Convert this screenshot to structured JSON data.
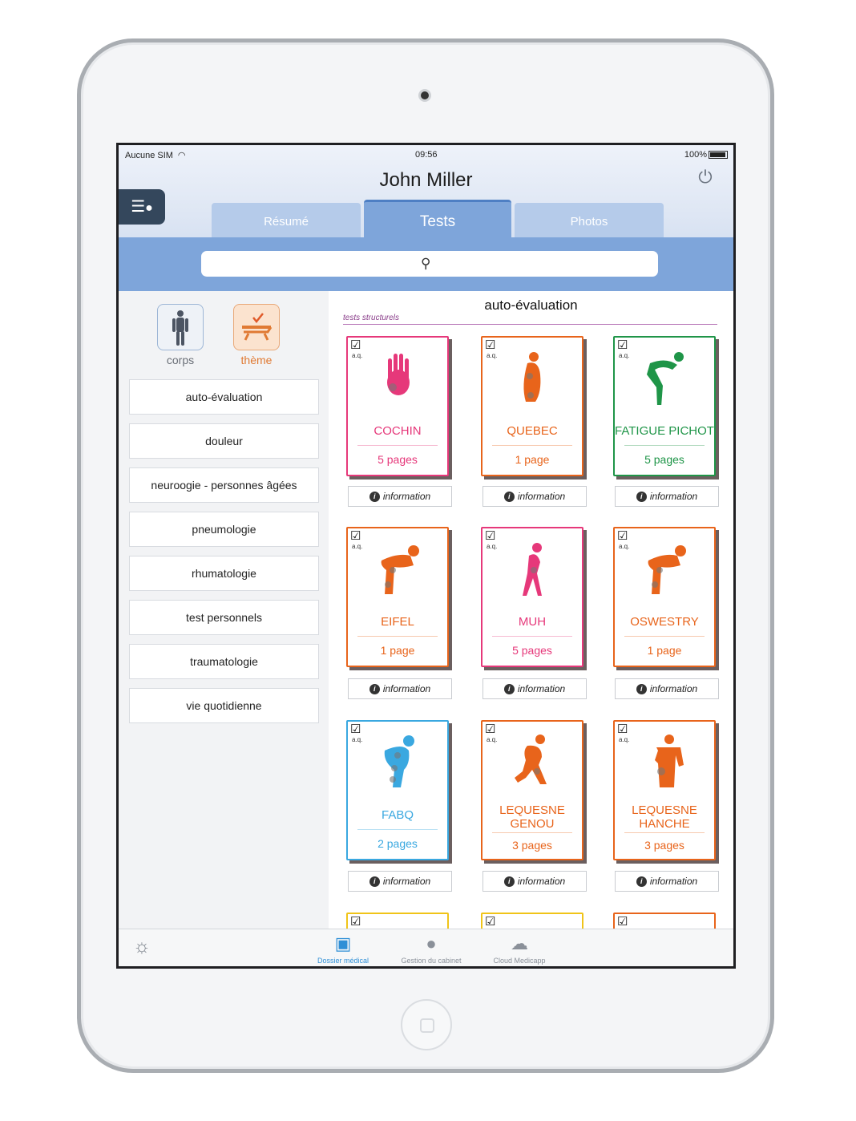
{
  "status": {
    "carrier": "Aucune SIM",
    "time": "09:56",
    "battery": "100%"
  },
  "header": {
    "patient_name": "John Miller"
  },
  "tabs": [
    {
      "label": "Résumé"
    },
    {
      "label": "Tests"
    },
    {
      "label": "Photos"
    }
  ],
  "filters": {
    "body_label": "corps",
    "theme_label": "thème"
  },
  "categories": [
    "auto-évaluation",
    "douleur",
    "neuroogie - personnes âgées",
    "pneumologie",
    "rhumatologie",
    "test personnels",
    "traumatologie",
    "vie quotidienne"
  ],
  "main": {
    "title": "auto-évaluation",
    "subtitle": "tests structurels"
  },
  "cards": [
    {
      "name": "COCHIN",
      "pages": "5 pages",
      "color": "#e6387a",
      "aq": "a.q."
    },
    {
      "name": "QUEBEC",
      "pages": "1 page",
      "color": "#e8641b",
      "aq": "a.q."
    },
    {
      "name": "FATIGUE PICHOT",
      "pages": "5 pages",
      "color": "#1f9548",
      "aq": "a.q."
    },
    {
      "name": "EIFEL",
      "pages": "1 page",
      "color": "#e8641b",
      "aq": "a.q."
    },
    {
      "name": "MUH",
      "pages": "5 pages",
      "color": "#e6387a",
      "aq": "a.q."
    },
    {
      "name": "OSWESTRY",
      "pages": "1 page",
      "color": "#e8641b",
      "aq": "a.q."
    },
    {
      "name": "FABQ",
      "pages": "2 pages",
      "color": "#3aa8e0",
      "aq": "a.q."
    },
    {
      "name": "LEQUESNE GENOU",
      "pages": "3 pages",
      "color": "#e8641b",
      "aq": "a.q."
    },
    {
      "name": "LEQUESNE HANCHE",
      "pages": "3 pages",
      "color": "#e8641b",
      "aq": "a.q."
    }
  ],
  "info_label": "information",
  "tabbar": {
    "items": [
      "Dossier médical",
      "Gestion du cabinet",
      "Cloud Medicapp"
    ]
  }
}
